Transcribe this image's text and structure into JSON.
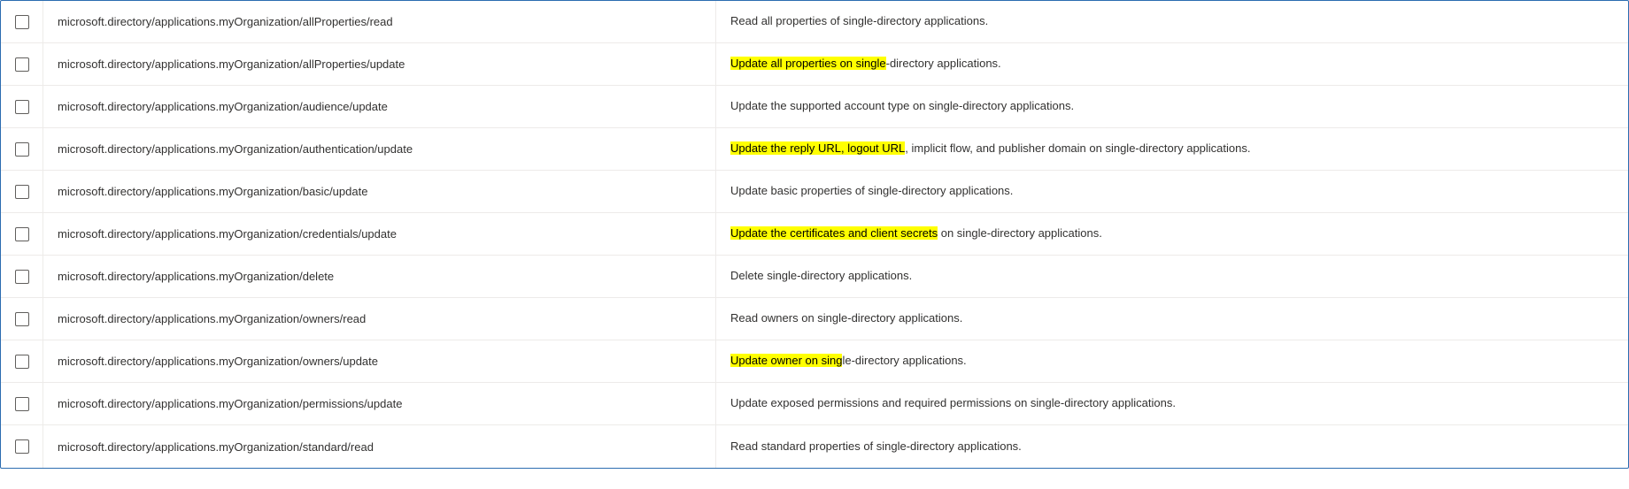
{
  "rows": [
    {
      "id": "row-1",
      "permission": "microsoft.directory/applications.myOrganization/allProperties/read",
      "description": {
        "parts": [
          {
            "text": "Read all properties of single-directory applications.",
            "highlight": false
          }
        ]
      }
    },
    {
      "id": "row-2",
      "permission": "microsoft.directory/applications.myOrganization/allProperties/update",
      "description": {
        "parts": [
          {
            "text": "Update all properties on single",
            "highlight": true
          },
          {
            "text": "-directory applications.",
            "highlight": false
          }
        ]
      }
    },
    {
      "id": "row-3",
      "permission": "microsoft.directory/applications.myOrganization/audience/update",
      "description": {
        "parts": [
          {
            "text": "Update the supported account type on single-directory applications.",
            "highlight": false
          }
        ]
      }
    },
    {
      "id": "row-4",
      "permission": "microsoft.directory/applications.myOrganization/authentication/update",
      "description": {
        "parts": [
          {
            "text": "Update the reply URL, logout URL",
            "highlight": true
          },
          {
            "text": ", implicit flow, and publisher domain on single-directory applications.",
            "highlight": false
          }
        ]
      }
    },
    {
      "id": "row-5",
      "permission": "microsoft.directory/applications.myOrganization/basic/update",
      "description": {
        "parts": [
          {
            "text": "Update basic properties of single-directory applications.",
            "highlight": false
          }
        ]
      }
    },
    {
      "id": "row-6",
      "permission": "microsoft.directory/applications.myOrganization/credentials/update",
      "description": {
        "parts": [
          {
            "text": "Update the certificates and client secrets",
            "highlight": true
          },
          {
            "text": " on single-directory applications.",
            "highlight": false
          }
        ]
      }
    },
    {
      "id": "row-7",
      "permission": "microsoft.directory/applications.myOrganization/delete",
      "description": {
        "parts": [
          {
            "text": "Delete single-directory applications.",
            "highlight": false
          }
        ]
      }
    },
    {
      "id": "row-8",
      "permission": "microsoft.directory/applications.myOrganization/owners/read",
      "description": {
        "parts": [
          {
            "text": "Read owners on single-directory applications.",
            "highlight": false
          }
        ]
      }
    },
    {
      "id": "row-9",
      "permission": "microsoft.directory/applications.myOrganization/owners/update",
      "description": {
        "parts": [
          {
            "text": "Update owner on sing",
            "highlight": true
          },
          {
            "text": "le-directory applications.",
            "highlight": false
          }
        ]
      }
    },
    {
      "id": "row-10",
      "permission": "microsoft.directory/applications.myOrganization/permissions/update",
      "description": {
        "parts": [
          {
            "text": "Update exposed permissions and required permissions on single-directory applications.",
            "highlight": false
          }
        ]
      }
    },
    {
      "id": "row-11",
      "permission": "microsoft.directory/applications.myOrganization/standard/read",
      "description": {
        "parts": [
          {
            "text": "Read standard properties of single-directory applications.",
            "highlight": false
          }
        ]
      }
    }
  ]
}
